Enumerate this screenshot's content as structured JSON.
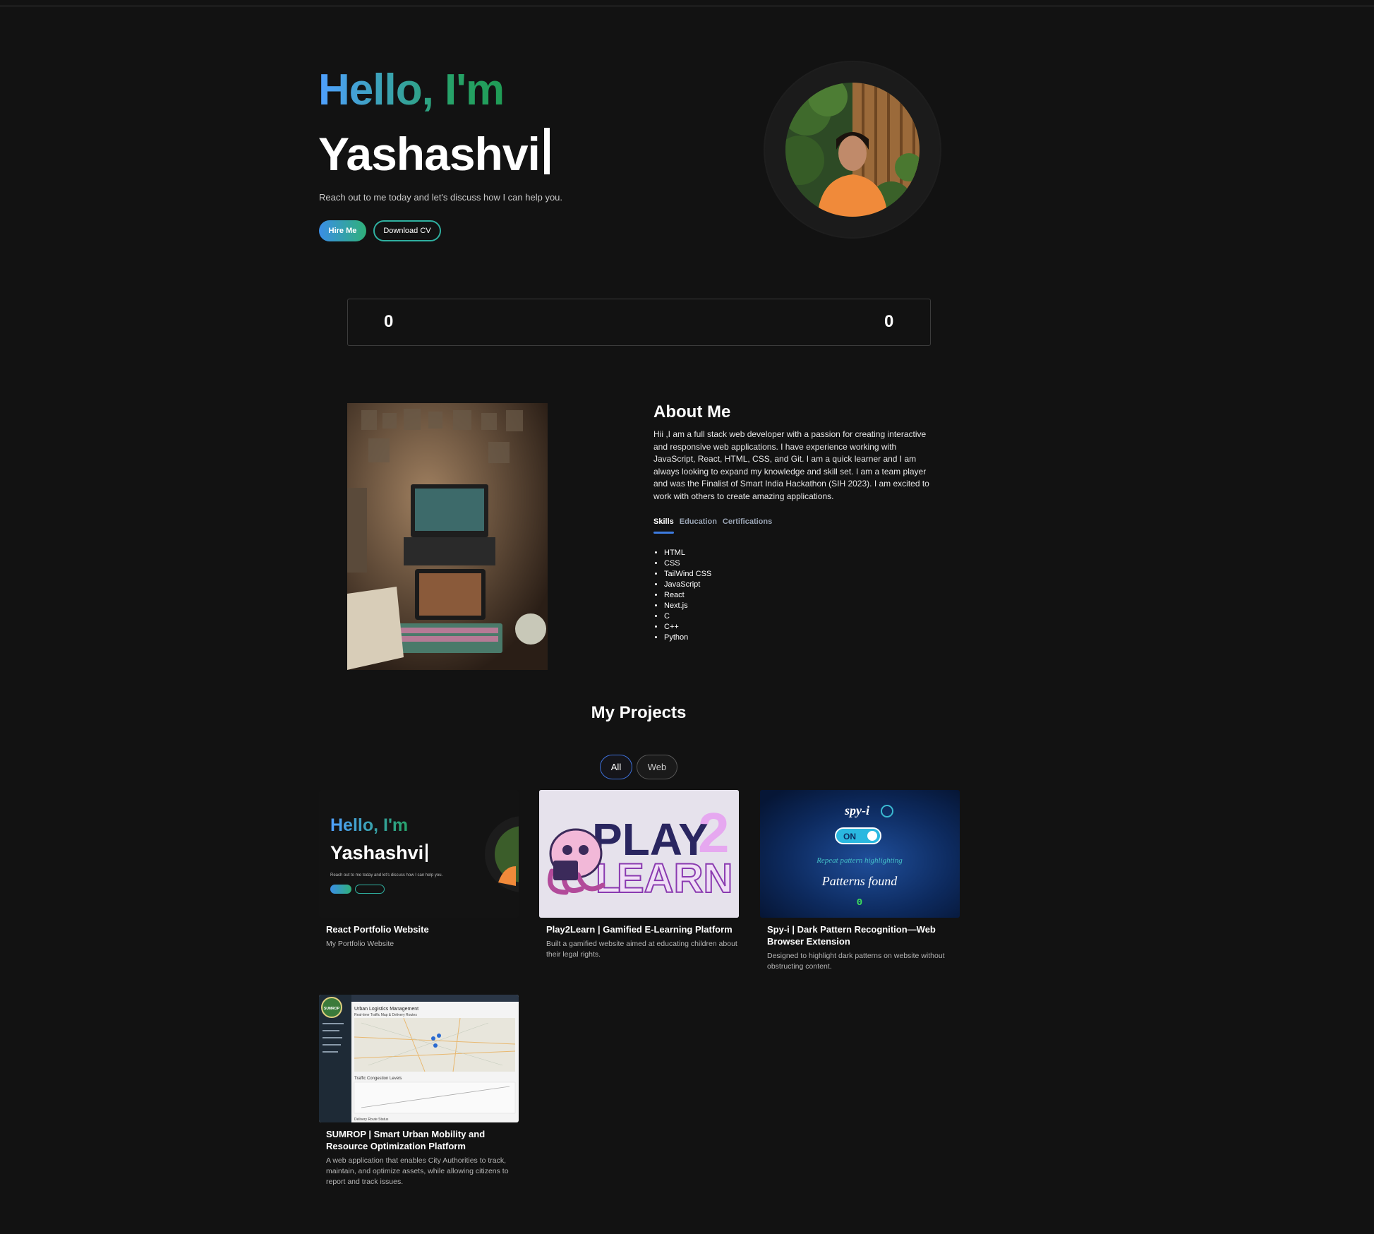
{
  "hero": {
    "greeting": "Hello, I'm",
    "name": "Yashashvi",
    "subtitle": "Reach out to me today and let's discuss how I can help you.",
    "hire_label": "Hire Me",
    "cv_label": "Download CV"
  },
  "stats": {
    "left_value": "0",
    "right_value": "0"
  },
  "about": {
    "title": "About Me",
    "text": "Hii ,I am a full stack web developer with a passion for creating interactive and responsive web applications. I have experience working with JavaScript, React, HTML, CSS, and Git. I am a quick learner and I am always looking to expand my knowledge and skill set. I am a team player and was the Finalist of Smart India Hackathon (SIH 2023). I am excited to work with others to create amazing applications.",
    "tabs": [
      "Skills",
      "Education",
      "Certifications"
    ],
    "active_tab": "Skills",
    "skills": [
      "HTML",
      "CSS",
      "TailWind CSS",
      "JavaScript",
      "React",
      "Next.js",
      "C",
      "C++",
      "Python"
    ]
  },
  "projects": {
    "title": "My Projects",
    "filters": [
      "All",
      "Web"
    ],
    "active_filter": "All",
    "items": [
      {
        "title": "React Portfolio Website",
        "desc": "My Portfolio Website",
        "thumb": {
          "greeting": "Hello, I'm",
          "name": "Yashashvi",
          "sub": "Reach out to me today and let's discuss how I can help you."
        }
      },
      {
        "title": "Play2Learn | Gamified E-Learning Platform",
        "desc": "Built a gamified website aimed at educating children about their legal rights.",
        "thumb": {
          "word1": "PLAY",
          "num": "2",
          "word2": "EARN",
          "letter": "L"
        }
      },
      {
        "title": "Spy-i | Dark Pattern Recognition—Web Browser Extension",
        "desc": "Designed to highlight dark patterns on website without obstructing content.",
        "thumb": {
          "brand": "spy-i",
          "toggle": "ON",
          "repeat": "Repeat pattern highlighting",
          "found": "Patterns found",
          "count": "0"
        }
      },
      {
        "title": "SUMROP | Smart Urban Mobility and Resource Optimization Platform",
        "desc": "A web application that enables City Authorities to track, maintain, and optimize assets, while allowing citizens to report and track issues.",
        "thumb": {
          "logo": "SUMROP",
          "heading": "Urban Logistics Management",
          "sub": "Real-time Traffic Map & Delivery Routes",
          "chart_label": "Traffic Congestion Levels",
          "footer": "Delivery Route Status"
        }
      }
    ]
  },
  "colors": {
    "background": "#121212",
    "accent_blue": "#3d7be0",
    "accent_green": "#27a36a"
  }
}
